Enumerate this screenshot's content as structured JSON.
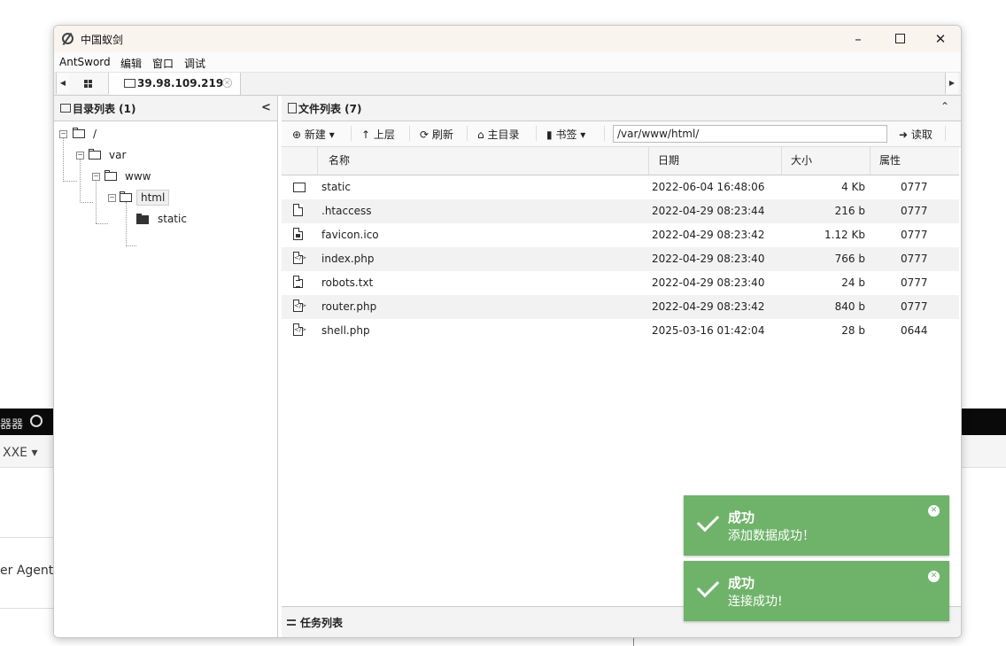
{
  "window": {
    "title": "中国蚁剑"
  },
  "menu": [
    "AntSword",
    "编辑",
    "窗口",
    "调试"
  ],
  "tabs": {
    "active_label": "39.98.109.219"
  },
  "left_panel": {
    "title": "目录列表 (1)",
    "tree": {
      "root": "/",
      "var": "var",
      "www": "www",
      "html": "html",
      "static": "static"
    }
  },
  "right_panel": {
    "title": "文件列表 (7)",
    "toolbar": {
      "new": "新建",
      "up": "上层",
      "refresh": "刷新",
      "home": "主目录",
      "bookmark": "书签",
      "path": "/var/www/html/",
      "read": "读取"
    },
    "columns": {
      "name": "名称",
      "date": "日期",
      "size": "大小",
      "attr": "属性"
    },
    "files": [
      {
        "icon": "folder-icon",
        "name": "static",
        "date": "2022-06-04 16:48:06",
        "size": "4 Kb",
        "attr": "0777"
      },
      {
        "icon": "file-icon",
        "name": ".htaccess",
        "date": "2022-04-29 08:23:44",
        "size": "216 b",
        "attr": "0777"
      },
      {
        "icon": "image-file-icon",
        "name": "favicon.ico",
        "date": "2022-04-29 08:23:42",
        "size": "1.12 Kb",
        "attr": "0777"
      },
      {
        "icon": "code-file-icon",
        "name": "index.php",
        "date": "2022-04-29 08:23:40",
        "size": "766 b",
        "attr": "0777"
      },
      {
        "icon": "text-file-icon",
        "name": "robots.txt",
        "date": "2022-04-29 08:23:40",
        "size": "24 b",
        "attr": "0777"
      },
      {
        "icon": "code-file-icon",
        "name": "router.php",
        "date": "2022-04-29 08:23:42",
        "size": "840 b",
        "attr": "0777"
      },
      {
        "icon": "code-file-icon",
        "name": "shell.php",
        "date": "2025-03-16 01:42:04",
        "size": "28 b",
        "attr": "0644"
      }
    ],
    "task_list": "任务列表"
  },
  "toasts": [
    {
      "title": "成功",
      "message": "添加数据成功！"
    },
    {
      "title": "成功",
      "message": "连接成功!"
    }
  ],
  "background": {
    "text1": "器器",
    "select": "XXE ▾",
    "agent": "er Agent"
  },
  "colors": {
    "toast_bg": "#6fb36a",
    "titlebar_bg": "#faf4ef"
  }
}
